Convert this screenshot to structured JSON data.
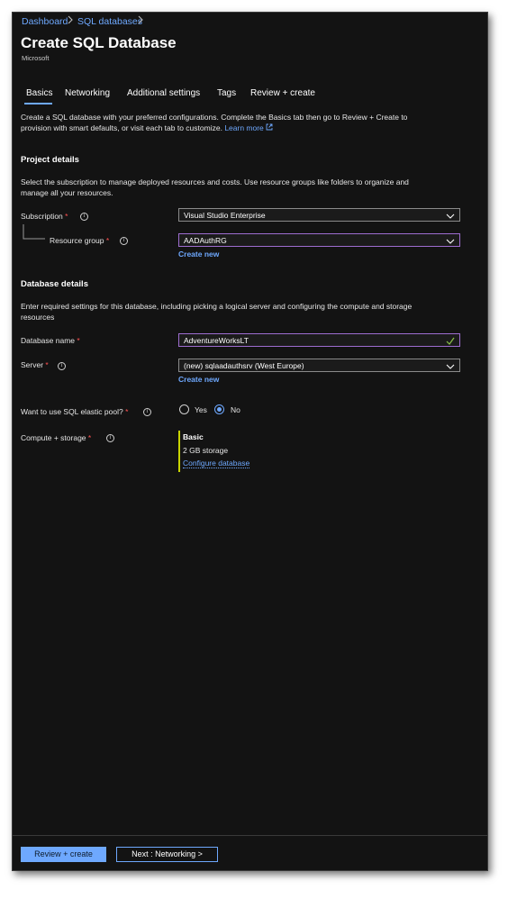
{
  "breadcrumb": {
    "items": [
      "Dashboard",
      "SQL databases"
    ]
  },
  "header": {
    "title": "Create SQL Database",
    "publisher": "Microsoft"
  },
  "tabs": [
    {
      "label": "Basics",
      "active": true
    },
    {
      "label": "Networking"
    },
    {
      "label": "Additional settings"
    },
    {
      "label": "Tags"
    },
    {
      "label": "Review + create"
    }
  ],
  "intro": {
    "line1": "Create a SQL database with your preferred configurations. Complete the Basics tab then go to Review + Create to",
    "line2": "provision with smart defaults, or visit each tab to customize.",
    "learn_more": "Learn more"
  },
  "project": {
    "heading": "Project details",
    "desc_line1": "Select the subscription to manage deployed resources and costs. Use resource groups like folders to organize and",
    "desc_line2": "manage all your resources.",
    "subscription_label": "Subscription",
    "subscription_value": "Visual Studio Enterprise",
    "rg_label": "Resource group",
    "rg_value": "AADAuthRG",
    "create_new": "Create new"
  },
  "database": {
    "heading": "Database details",
    "desc_line1": "Enter required settings for this database, including picking a logical server and configuring the compute and storage",
    "desc_line2": "resources",
    "name_label": "Database name",
    "name_value": "AdventureWorksLT",
    "server_label": "Server",
    "server_value": "(new) sqlaadauthsrv (West Europe)",
    "server_create_new": "Create new",
    "pool_label": "Want to use SQL elastic pool?",
    "pool_yes": "Yes",
    "pool_no": "No",
    "pool_selected": "No",
    "compute_label": "Compute + storage",
    "compute_tier": "Basic",
    "compute_storage": "2 GB storage",
    "configure_link": "Configure database"
  },
  "required_mark": "*",
  "info_glyph": "i",
  "footer": {
    "review_button": "Review + create",
    "next_button": "Next : Networking >"
  },
  "colors": {
    "accent": "#6ea8fe",
    "required": "#ff5252",
    "focus": "#9e6dd0",
    "valid": "#8bc34a",
    "compute_bar": "#c8d400",
    "background": "#131313"
  },
  "icons": {
    "breadcrumb_separator": "chevron-right-icon",
    "dropdown": "chevron-down-icon",
    "external": "external-link-icon",
    "valid": "checkmark-icon",
    "info": "info-icon"
  }
}
